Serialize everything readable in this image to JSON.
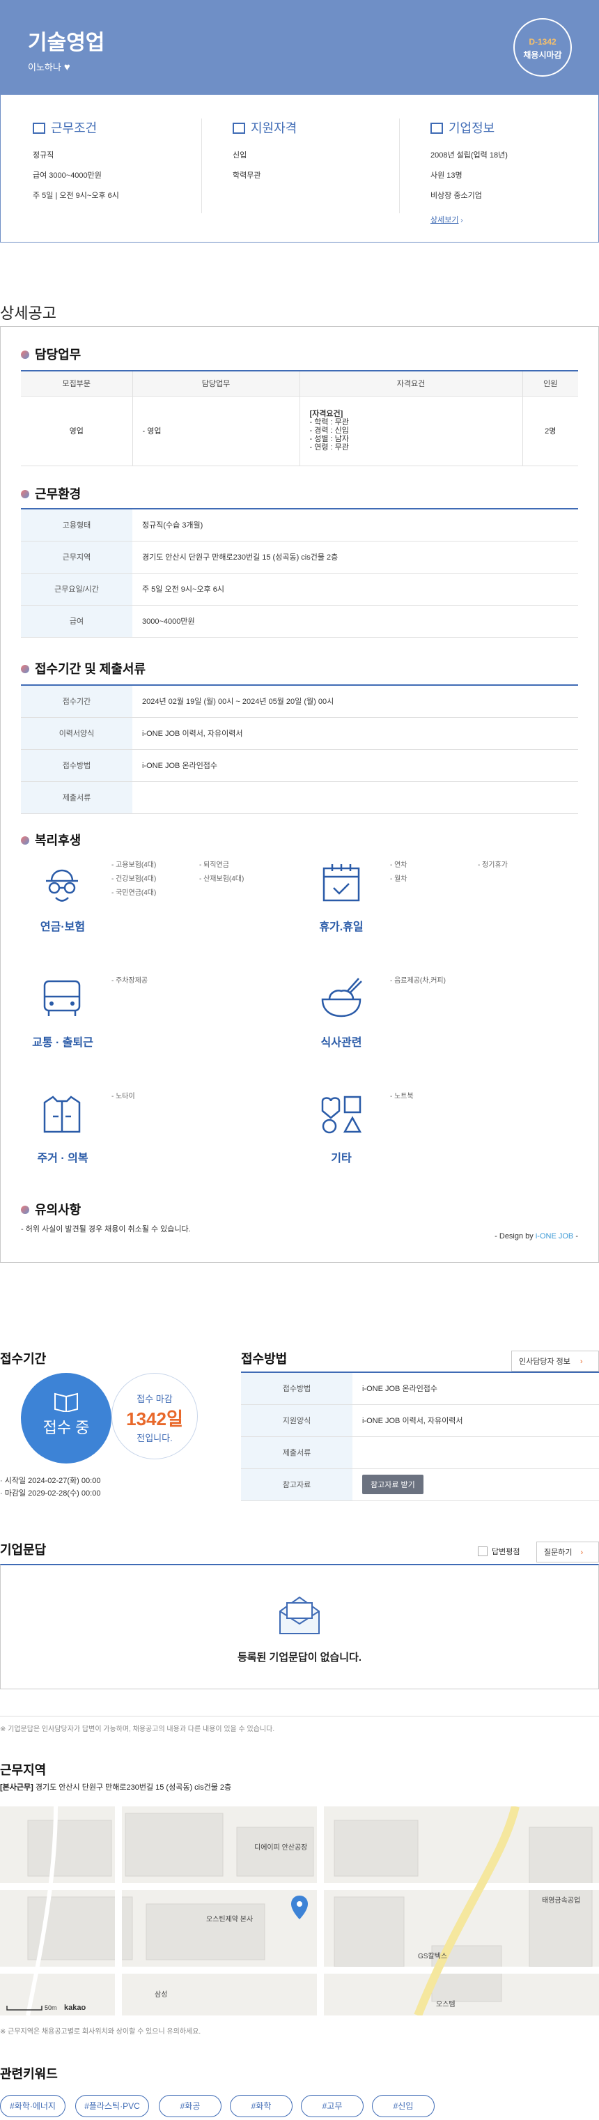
{
  "header": {
    "title": "기술영업",
    "company": "이노하나",
    "dday": "D-1342",
    "dday_sub": "채용시마감"
  },
  "summary": {
    "work": {
      "title": "근무조건",
      "lines": [
        "정규직",
        "급여 3000~4000만원",
        "주 5일 | 오전 9시~오후 6시"
      ]
    },
    "qual": {
      "title": "지원자격",
      "lines": [
        "신입",
        "학력무관"
      ]
    },
    "company": {
      "title": "기업정보",
      "lines": [
        "2008년 설립(업력 18년)",
        "사원 13명",
        "비상장 중소기업"
      ],
      "link": "상세보기"
    }
  },
  "detail": {
    "title": "상세공고",
    "duty": {
      "title": "담당업무",
      "headers": [
        "모집부문",
        "담당업무",
        "자격요건",
        "인원"
      ],
      "row": {
        "part": "영업",
        "task": "- 영업",
        "req_title": "[자격요건]",
        "req_lines": [
          "- 학력 : 무관",
          "- 경력 : 신입",
          "- 성별 : 남자",
          "- 연령 : 무관"
        ],
        "count": "2명"
      }
    },
    "env": {
      "title": "근무환경",
      "rows": [
        {
          "k": "고용형태",
          "v": "정규직(수습 3개월)"
        },
        {
          "k": "근무지역",
          "v": "경기도 안산시 단원구 만해로230번길 15 (성곡동) cis건물 2층"
        },
        {
          "k": "근무요일/시간",
          "v": "주 5일 오전 9시~오후 6시"
        },
        {
          "k": "급여",
          "v": "3000~4000만원"
        }
      ]
    },
    "submit": {
      "title": "접수기간 및 제출서류",
      "rows": [
        {
          "k": "접수기간",
          "v": "2024년 02월 19일 (월) 00시 ~ 2024년 05월 20일 (월) 00시"
        },
        {
          "k": "이력서양식",
          "v": "i-ONE JOB 이력서, 자유이력서"
        },
        {
          "k": "접수방법",
          "v": "i-ONE JOB 온라인접수"
        },
        {
          "k": "제출서류",
          "v": ""
        }
      ]
    },
    "welfare": {
      "title": "복리후생",
      "items": [
        {
          "label": "연금·보험",
          "icon": "pension-icon",
          "col1": [
            "- 고용보험(4대)",
            "- 건강보험(4대)",
            "- 국민연금(4대)"
          ],
          "col2": [
            "- 퇴직연금",
            "- 산재보험(4대)"
          ]
        },
        {
          "label": "휴가.휴일",
          "icon": "calendar-icon",
          "col1": [
            "- 연차",
            "- 월차"
          ],
          "col2": [
            "- 정기휴가"
          ]
        },
        {
          "label": "교통 · 출퇴근",
          "icon": "bus-icon",
          "col1": [
            "- 주차장제공"
          ],
          "col2": []
        },
        {
          "label": "식사관련",
          "icon": "meal-bowl-icon",
          "col1": [
            "- 음료제공(차,커피)"
          ],
          "col2": []
        },
        {
          "label": "주거 · 의복",
          "icon": "clothing-icon",
          "col1": [
            "- 노타이"
          ],
          "col2": []
        },
        {
          "label": "기타",
          "icon": "shapes-icon",
          "col1": [
            "- 노트북"
          ],
          "col2": []
        }
      ]
    },
    "notice": {
      "title": "유의사항",
      "text": "- 허위 사실이 발견될 경우 채용이 취소될 수 있습니다.",
      "design_prefix": "- Design by ",
      "design_brand": "i-ONE JOB",
      "design_suffix": " -"
    }
  },
  "apply": {
    "period_title": "접수기간",
    "status": "접수 중",
    "deadline_label": "접수 마감",
    "days": "1342일",
    "days_suffix": "전입니다.",
    "start": "· 시작일 2024-02-27(화) 00:00",
    "end": "· 마감일 2029-02-28(수) 00:00",
    "method_title": "접수방법",
    "hr_button": "인사담당자 정보",
    "rows": [
      {
        "k": "접수방법",
        "v": "i-ONE JOB 온라인접수"
      },
      {
        "k": "지원양식",
        "v": "i-ONE JOB 이력서, 자유이력서"
      },
      {
        "k": "제출서류",
        "v": ""
      },
      {
        "k": "참고자료",
        "v": ""
      }
    ],
    "ref_button": "참고자료 받기"
  },
  "qa": {
    "title": "기업문답",
    "check_label": "답변평점",
    "ask_button": "질문하기",
    "empty": "등록된 기업문답이 없습니다.",
    "note": "※ 기업문답은 인사담당자가 답변이 가능하며, 채용공고의 내용과 다른 내용이 있을 수 있습니다."
  },
  "location": {
    "title": "근무지역",
    "tag": "[본사근무]",
    "address": "경기도 안산시 단원구 만해로230번길 15 (성곡동) cis건물 2층",
    "map_labels": [
      "디에이피\n안산공장",
      "오스틴제약\n본사",
      "삼성",
      "태영금속공업",
      "GS칼텍스",
      "오스템"
    ],
    "scale": "50m",
    "brand": "kakao",
    "note": "※ 근무지역은 채용공고별로 회사위치와 상이할 수 있으니 유의하세요."
  },
  "keywords": {
    "title": "관련키워드",
    "items": [
      "#화학·에너지",
      "#플라스틱·PVC",
      "#화공",
      "#화학",
      "#고무",
      "#신입"
    ]
  },
  "colors": {
    "brand": "#6f8fc6",
    "accent": "#3f6bb5",
    "orange": "#e8682a"
  }
}
